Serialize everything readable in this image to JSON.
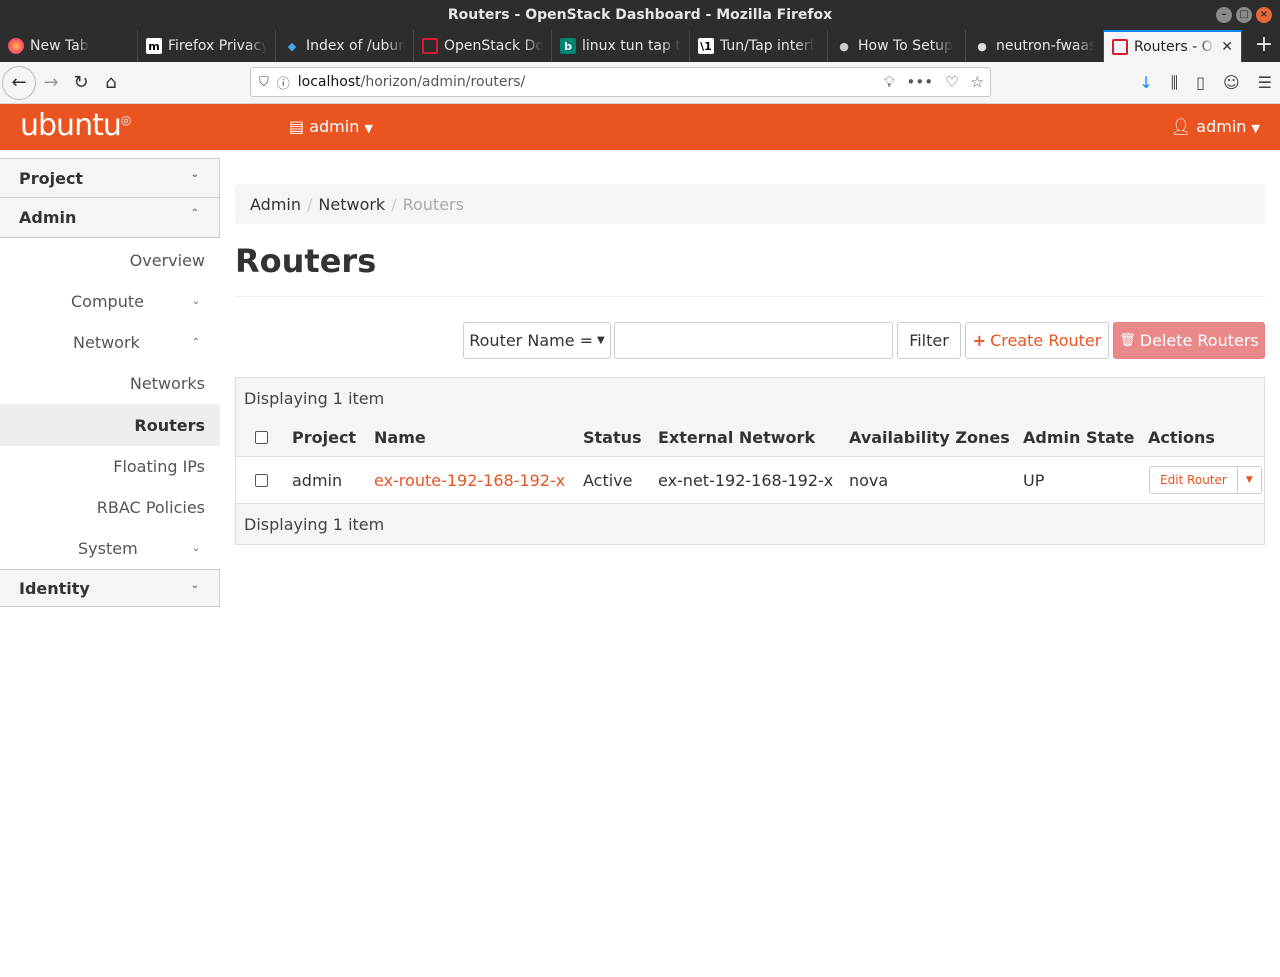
{
  "window": {
    "title": "Routers - OpenStack Dashboard - Mozilla Firefox"
  },
  "tabs": [
    {
      "label": "New Tab",
      "icon": "firefox-icon"
    },
    {
      "label": "Firefox Privacy",
      "icon": "m-icon"
    },
    {
      "label": "Index of /ubuntu",
      "icon": "bookmark-icon"
    },
    {
      "label": "OpenStack Docs",
      "icon": "openstack-icon"
    },
    {
      "label": "linux tun tap t",
      "icon": "bing-icon"
    },
    {
      "label": "Tun/Tap interf",
      "icon": "wiki-icon"
    },
    {
      "label": "How To Setup",
      "icon": "linux-icon"
    },
    {
      "label": "neutron-fwaas",
      "icon": "github-icon"
    },
    {
      "label": "Routers - Op",
      "icon": "openstack-icon"
    }
  ],
  "url": {
    "host": "localhost",
    "path": "/horizon/admin/routers/"
  },
  "header": {
    "logo": "ubuntu",
    "project_menu": "admin",
    "user_menu": "admin"
  },
  "sidebar": {
    "project": "Project",
    "admin": "Admin",
    "items": {
      "overview": "Overview",
      "compute": "Compute",
      "network": "Network",
      "networks": "Networks",
      "routers": "Routers",
      "floating_ips": "Floating IPs",
      "rbac_policies": "RBAC Policies",
      "system": "System"
    },
    "identity": "Identity"
  },
  "breadcrumb": {
    "admin": "Admin",
    "network": "Network",
    "current": "Routers"
  },
  "page_title": "Routers",
  "toolbar": {
    "filter_field": "Router Name =",
    "filter_button": "Filter",
    "create_button": "Create Router",
    "delete_button": "Delete Routers"
  },
  "table": {
    "displaying": "Displaying 1 item",
    "headers": {
      "project": "Project",
      "name": "Name",
      "status": "Status",
      "external_network": "External Network",
      "availability_zones": "Availability Zones",
      "admin_state": "Admin State",
      "actions": "Actions"
    },
    "rows": [
      {
        "project": "admin",
        "name": "ex-route-192-168-192-x",
        "status": "Active",
        "external_network": "ex-net-192-168-192-x",
        "availability_zones": "nova",
        "admin_state": "UP",
        "action": "Edit Router"
      }
    ],
    "footer": "Displaying 1 item"
  },
  "colors": {
    "brand": "#e95420",
    "delete": "#e9898a"
  }
}
